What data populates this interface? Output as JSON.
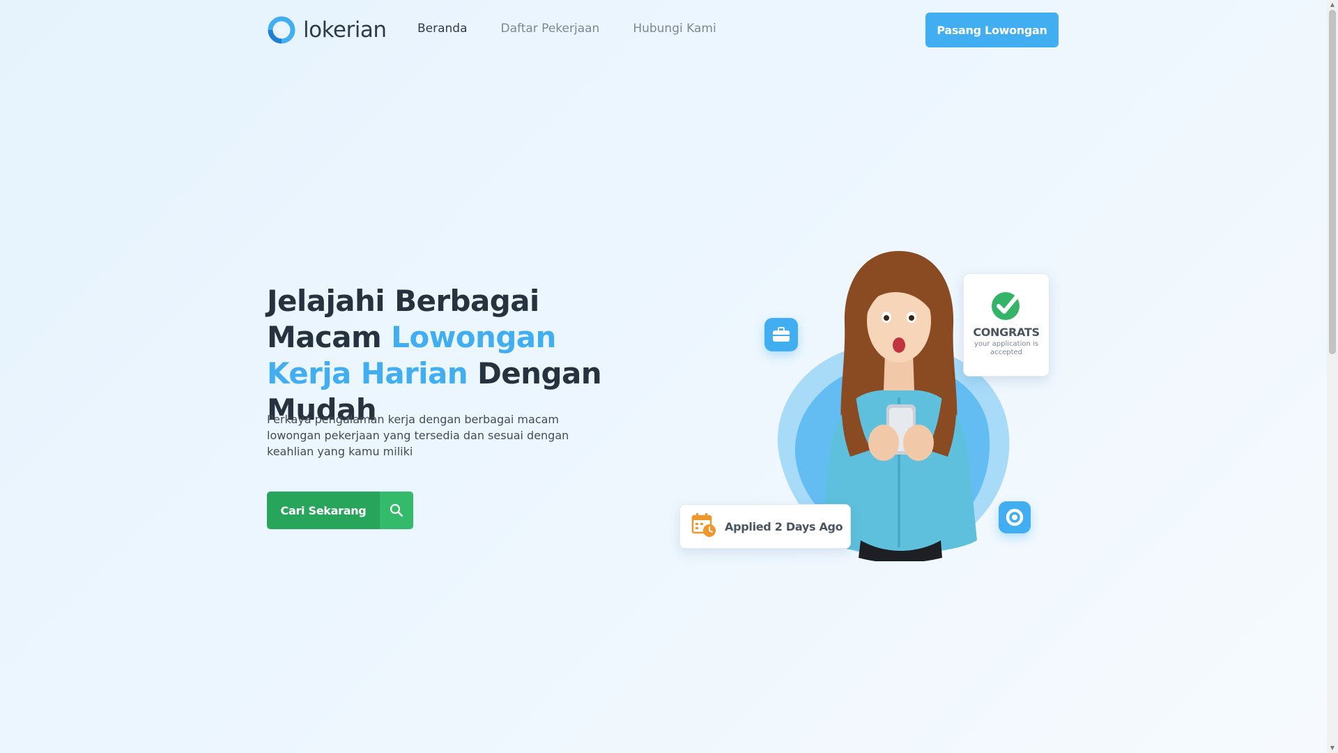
{
  "brand": {
    "name": "lokerian",
    "color_primary": "#41aef2",
    "color_cta": "#27a55a"
  },
  "nav": {
    "items": [
      {
        "label": "Beranda",
        "active": true
      },
      {
        "label": "Daftar Pekerjaan",
        "active": false
      },
      {
        "label": "Hubungi Kami",
        "active": false
      }
    ],
    "post_button": "Pasang Lowongan"
  },
  "hero": {
    "title_part1": "Jelajahi Berbagai Macam ",
    "title_accent": "Lowongan Kerja Harian",
    "title_part2": " Dengan Mudah",
    "description": "Perkaya pengalaman kerja dengan berbagai macam lowongan pekerjaan yang tersedia dan sesuai dengan keahlian yang kamu miliki",
    "cta_label": "Cari Sekarang",
    "cta_icon": "search-icon"
  },
  "illustration": {
    "congrats_title": "CONGRATS",
    "congrats_sub": "your application is accepted",
    "applied_text": "Applied 2 Days Ago",
    "icons": [
      "briefcase-icon",
      "check-circle-icon",
      "calendar-clock-icon",
      "lokerian-logo-icon"
    ]
  }
}
